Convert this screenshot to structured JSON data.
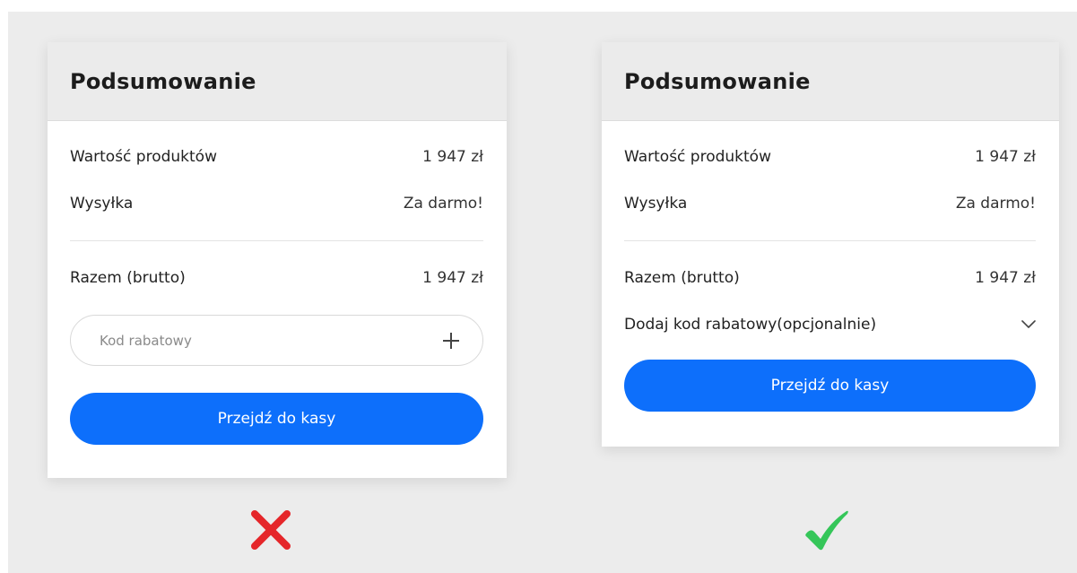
{
  "left_card": {
    "title": "Podsumowanie",
    "rows": [
      {
        "label": "Wartość produktów",
        "value": "1 947 zł"
      },
      {
        "label": "Wysyłka",
        "value": "Za darmo!"
      }
    ],
    "total": {
      "label": "Razem (brutto)",
      "value": "1 947 zł"
    },
    "coupon_placeholder": "Kod rabatowy",
    "checkout_label": "Przejdź do kasy"
  },
  "right_card": {
    "title": "Podsumowanie",
    "rows": [
      {
        "label": "Wartość produktów",
        "value": "1 947 zł"
      },
      {
        "label": "Wysyłka",
        "value": "Za darmo!"
      }
    ],
    "total": {
      "label": "Razem (brutto)",
      "value": "1 947 zł"
    },
    "discount_toggle_label": "Dodaj kod rabatowy(opcjonalnie)",
    "checkout_label": "Przejdź do kasy"
  },
  "verdicts": {
    "left": "cross-icon",
    "right": "checkmark-icon"
  },
  "colors": {
    "primary_button": "#0d6ffb",
    "cross": "#e5262a",
    "check": "#35c659",
    "stage_background": "#ececec"
  }
}
